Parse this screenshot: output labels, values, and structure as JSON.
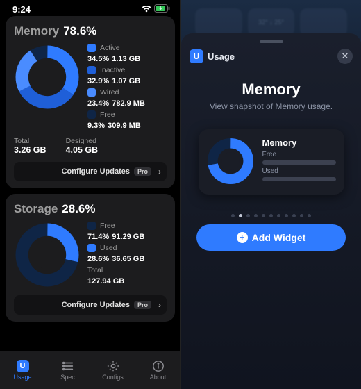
{
  "statusbar": {
    "time": "9:24"
  },
  "memory_card": {
    "title": "Memory",
    "pct": "78.6%",
    "legend": [
      {
        "label": "Active",
        "pct": "34.5%",
        "size": "1.13 GB",
        "color": "#2f7bff"
      },
      {
        "label": "Inactive",
        "pct": "32.9%",
        "size": "1.07 GB",
        "color": "#1f5fd8"
      },
      {
        "label": "Wired",
        "pct": "23.4%",
        "size": "782.9 MB",
        "color": "#4a8cff"
      },
      {
        "label": "Free",
        "pct": "9.3%",
        "size": "309.9 MB",
        "color": "#0f2546"
      }
    ],
    "bottom": [
      {
        "label": "Total",
        "value": "3.26 GB"
      },
      {
        "label": "Designed",
        "value": "4.05 GB"
      }
    ]
  },
  "storage_card": {
    "title": "Storage",
    "pct": "28.6%",
    "legend": [
      {
        "label": "Free",
        "pct": "71.4%",
        "size": "91.29 GB",
        "color": "#0f2546"
      },
      {
        "label": "Used",
        "pct": "28.6%",
        "size": "36.65 GB",
        "color": "#2f7bff"
      }
    ],
    "bottom": [
      {
        "label": "Total",
        "value": "127.94 GB"
      }
    ]
  },
  "configure": {
    "label": "Configure Updates",
    "badge": "Pro"
  },
  "tabs": {
    "usage": "Usage",
    "spec": "Spec",
    "configs": "Configs",
    "about": "About"
  },
  "sheet": {
    "app_name": "Usage",
    "hero_title": "Memory",
    "hero_sub": "View snapshot of Memory usage.",
    "preview_title": "Memory",
    "preview_rows": [
      "Free",
      "Used"
    ],
    "page_count": 11,
    "page_index": 1,
    "add_label": "Add Widget"
  },
  "blur_widgets_text": "32° ↓ 25°",
  "chart_data": [
    {
      "type": "pie",
      "title": "Memory 78.6%",
      "series": [
        {
          "name": "Active",
          "value": 34.5
        },
        {
          "name": "Inactive",
          "value": 32.9
        },
        {
          "name": "Wired",
          "value": 23.4
        },
        {
          "name": "Free",
          "value": 9.3
        }
      ],
      "unit": "%"
    },
    {
      "type": "pie",
      "title": "Storage 28.6%",
      "series": [
        {
          "name": "Free",
          "value": 71.4
        },
        {
          "name": "Used",
          "value": 28.6
        }
      ],
      "unit": "%"
    }
  ]
}
